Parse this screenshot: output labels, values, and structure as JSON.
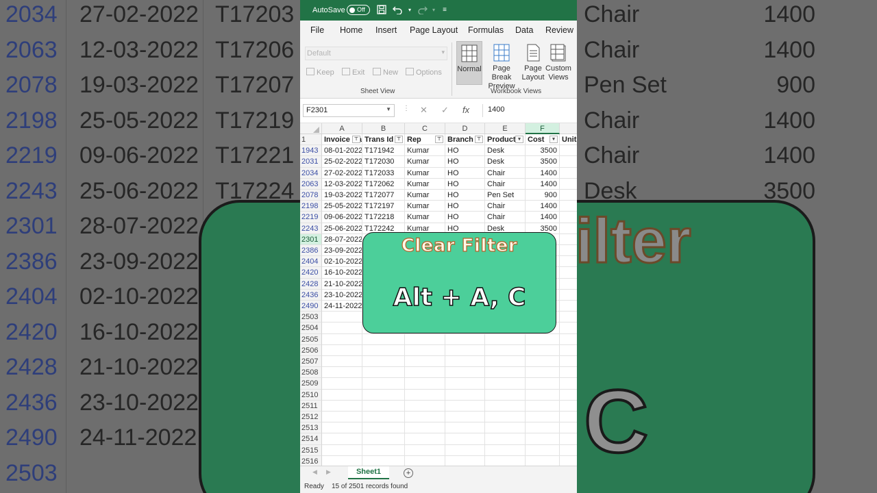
{
  "background": {
    "rows": [
      {
        "num": "2034",
        "date": "27-02-2022",
        "trans": "T17203",
        "product": "Chair",
        "cost": "1400"
      },
      {
        "num": "2063",
        "date": "12-03-2022",
        "trans": "T17206",
        "product": "Chair",
        "cost": "1400"
      },
      {
        "num": "2078",
        "date": "19-03-2022",
        "trans": "T17207",
        "product": "Pen Set",
        "cost": "900"
      },
      {
        "num": "2198",
        "date": "25-05-2022",
        "trans": "T17219",
        "product": "Chair",
        "cost": "1400"
      },
      {
        "num": "2219",
        "date": "09-06-2022",
        "trans": "T17221",
        "product": "Chair",
        "cost": "1400"
      },
      {
        "num": "2243",
        "date": "25-06-2022",
        "trans": "T17224",
        "product": "Desk",
        "cost": "3500"
      },
      {
        "num": "2301",
        "date": "28-07-2022",
        "trans": "",
        "product": "",
        "cost": ""
      },
      {
        "num": "2386",
        "date": "23-09-2022",
        "trans": "",
        "product": "",
        "cost": ""
      },
      {
        "num": "2404",
        "date": "02-10-2022",
        "trans": "",
        "product": "",
        "cost": ""
      },
      {
        "num": "2420",
        "date": "16-10-2022",
        "trans": "",
        "product": "",
        "cost": ""
      },
      {
        "num": "2428",
        "date": "21-10-2022",
        "trans": "",
        "product": "",
        "cost": ""
      },
      {
        "num": "2436",
        "date": "23-10-2022",
        "trans": "",
        "product": "",
        "cost": ""
      },
      {
        "num": "2490",
        "date": "24-11-2022",
        "trans": "",
        "product": "",
        "cost": ""
      },
      {
        "num": "2503",
        "date": "",
        "trans": "",
        "product": "",
        "cost": ""
      }
    ],
    "big_title": "ilter",
    "big_keys": ", C"
  },
  "titlebar": {
    "autosave_label": "AutoSave",
    "autosave_state": "Off"
  },
  "menu": [
    "File",
    "Home",
    "Insert",
    "Page Layout",
    "Formulas",
    "Data",
    "Review"
  ],
  "ribbon": {
    "view_select_value": "Default",
    "sheet_view_buttons": [
      "Keep",
      "Exit",
      "New",
      "Options"
    ],
    "sheet_view_label": "Sheet View",
    "workbook_buttons": [
      {
        "label": "Normal"
      },
      {
        "label": "Page Break Preview"
      },
      {
        "label": "Page Layout"
      },
      {
        "label": "Custom Views"
      }
    ],
    "workbook_label": "Workbook Views"
  },
  "formula_bar": {
    "name_box": "F2301",
    "cancel_icon": "✕",
    "enter_icon": "✓",
    "fx_icon": "fx",
    "value": "1400"
  },
  "grid": {
    "columns": [
      "A",
      "B",
      "C",
      "D",
      "E",
      "F"
    ],
    "selected_column": "F",
    "header_row_num": "1",
    "headers": [
      "Invoice Da",
      "Trans Id",
      "Rep",
      "Branch",
      "Product",
      "Cost",
      "Units"
    ],
    "rows": [
      {
        "num": "1943",
        "date": "08-01-2022",
        "trans": "T171942",
        "rep": "Kumar",
        "branch": "HO",
        "product": "Desk",
        "cost": "3500"
      },
      {
        "num": "2031",
        "date": "25-02-2022",
        "trans": "T172030",
        "rep": "Kumar",
        "branch": "HO",
        "product": "Desk",
        "cost": "3500"
      },
      {
        "num": "2034",
        "date": "27-02-2022",
        "trans": "T172033",
        "rep": "Kumar",
        "branch": "HO",
        "product": "Chair",
        "cost": "1400"
      },
      {
        "num": "2063",
        "date": "12-03-2022",
        "trans": "T172062",
        "rep": "Kumar",
        "branch": "HO",
        "product": "Chair",
        "cost": "1400"
      },
      {
        "num": "2078",
        "date": "19-03-2022",
        "trans": "T172077",
        "rep": "Kumar",
        "branch": "HO",
        "product": "Pen Set",
        "cost": "900"
      },
      {
        "num": "2198",
        "date": "25-05-2022",
        "trans": "T172197",
        "rep": "Kumar",
        "branch": "HO",
        "product": "Chair",
        "cost": "1400"
      },
      {
        "num": "2219",
        "date": "09-06-2022",
        "trans": "T172218",
        "rep": "Kumar",
        "branch": "HO",
        "product": "Chair",
        "cost": "1400"
      },
      {
        "num": "2243",
        "date": "25-06-2022",
        "trans": "T172242",
        "rep": "Kumar",
        "branch": "HO",
        "product": "Desk",
        "cost": "3500"
      },
      {
        "num": "2301",
        "date": "28-07-2022",
        "trans": "",
        "rep": "",
        "branch": "",
        "product": "",
        "cost": ""
      },
      {
        "num": "2386",
        "date": "23-09-2022",
        "trans": "",
        "rep": "",
        "branch": "",
        "product": "",
        "cost": ""
      },
      {
        "num": "2404",
        "date": "02-10-2022",
        "trans": "",
        "rep": "",
        "branch": "",
        "product": "",
        "cost": ""
      },
      {
        "num": "2420",
        "date": "16-10-2022",
        "trans": "",
        "rep": "",
        "branch": "",
        "product": "",
        "cost": ""
      },
      {
        "num": "2428",
        "date": "21-10-2022",
        "trans": "",
        "rep": "",
        "branch": "",
        "product": "",
        "cost": ""
      },
      {
        "num": "2436",
        "date": "23-10-2022",
        "trans": "",
        "rep": "",
        "branch": "",
        "product": "",
        "cost": ""
      },
      {
        "num": "2490",
        "date": "24-11-2022",
        "trans": "",
        "rep": "",
        "branch": "",
        "product": "",
        "cost": ""
      }
    ],
    "empty_rows": [
      "2503",
      "2504",
      "2505",
      "2506",
      "2507",
      "2508",
      "2509",
      "2510",
      "2511",
      "2512",
      "2513",
      "2514",
      "2515",
      "2516"
    ]
  },
  "sheet_tabs": {
    "active": "Sheet1",
    "add_icon": "+"
  },
  "status": {
    "mode": "Ready",
    "records": "15 of 2501 records found"
  },
  "callout": {
    "title": "Clear Filter",
    "keys": "Alt + A, C"
  },
  "colors": {
    "excel_green": "#217346",
    "callout_green": "#4ccf9a",
    "row_number_blue": "#3b4ea5"
  }
}
